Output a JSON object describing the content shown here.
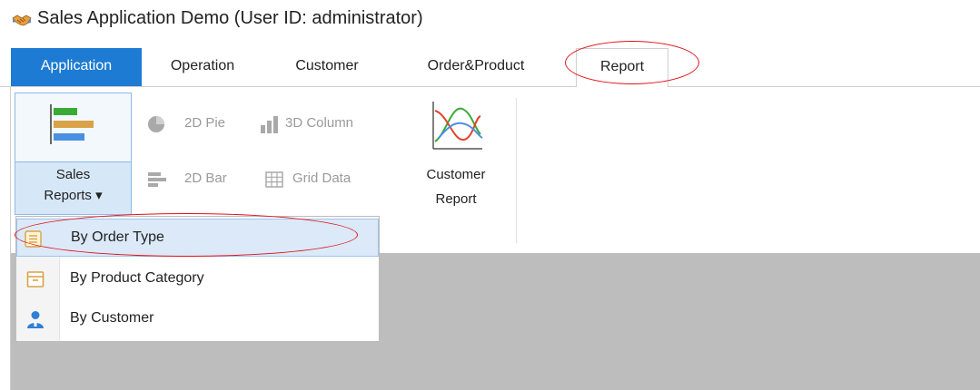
{
  "window": {
    "title": "Sales Application Demo (User ID: administrator)",
    "icon": "handshake-icon"
  },
  "tabs": [
    {
      "label": "Application",
      "active": true
    },
    {
      "label": "Operation"
    },
    {
      "label": "Customer"
    },
    {
      "label": "Order&Product"
    },
    {
      "label": "Report",
      "selected": true
    }
  ],
  "ribbon": {
    "sales_reports": {
      "line1": "Sales",
      "line2": "Reports ▾",
      "icon": "bar-chart-icon"
    },
    "pie_2d": {
      "label": "2D Pie",
      "icon": "pie-chart-icon"
    },
    "column_3d": {
      "label": "3D Column",
      "icon": "column-chart-icon"
    },
    "bar_2d": {
      "label": "2D Bar",
      "icon": "bar-chart-icon"
    },
    "grid_data": {
      "label": "Grid Data",
      "icon": "grid-icon"
    },
    "customer_report": {
      "line1": "Customer",
      "line2": "Report",
      "icon": "line-chart-icon"
    }
  },
  "dropdown": {
    "items": [
      {
        "label": "By Order Type",
        "icon": "list-icon",
        "highlighted": true
      },
      {
        "label": "By Product Category",
        "icon": "box-icon"
      },
      {
        "label": "By Customer",
        "icon": "user-icon"
      }
    ]
  },
  "colors": {
    "accent": "#1e7bd3",
    "highlight_annotation": "#e0121b",
    "workspace": "#bdbdbd"
  }
}
